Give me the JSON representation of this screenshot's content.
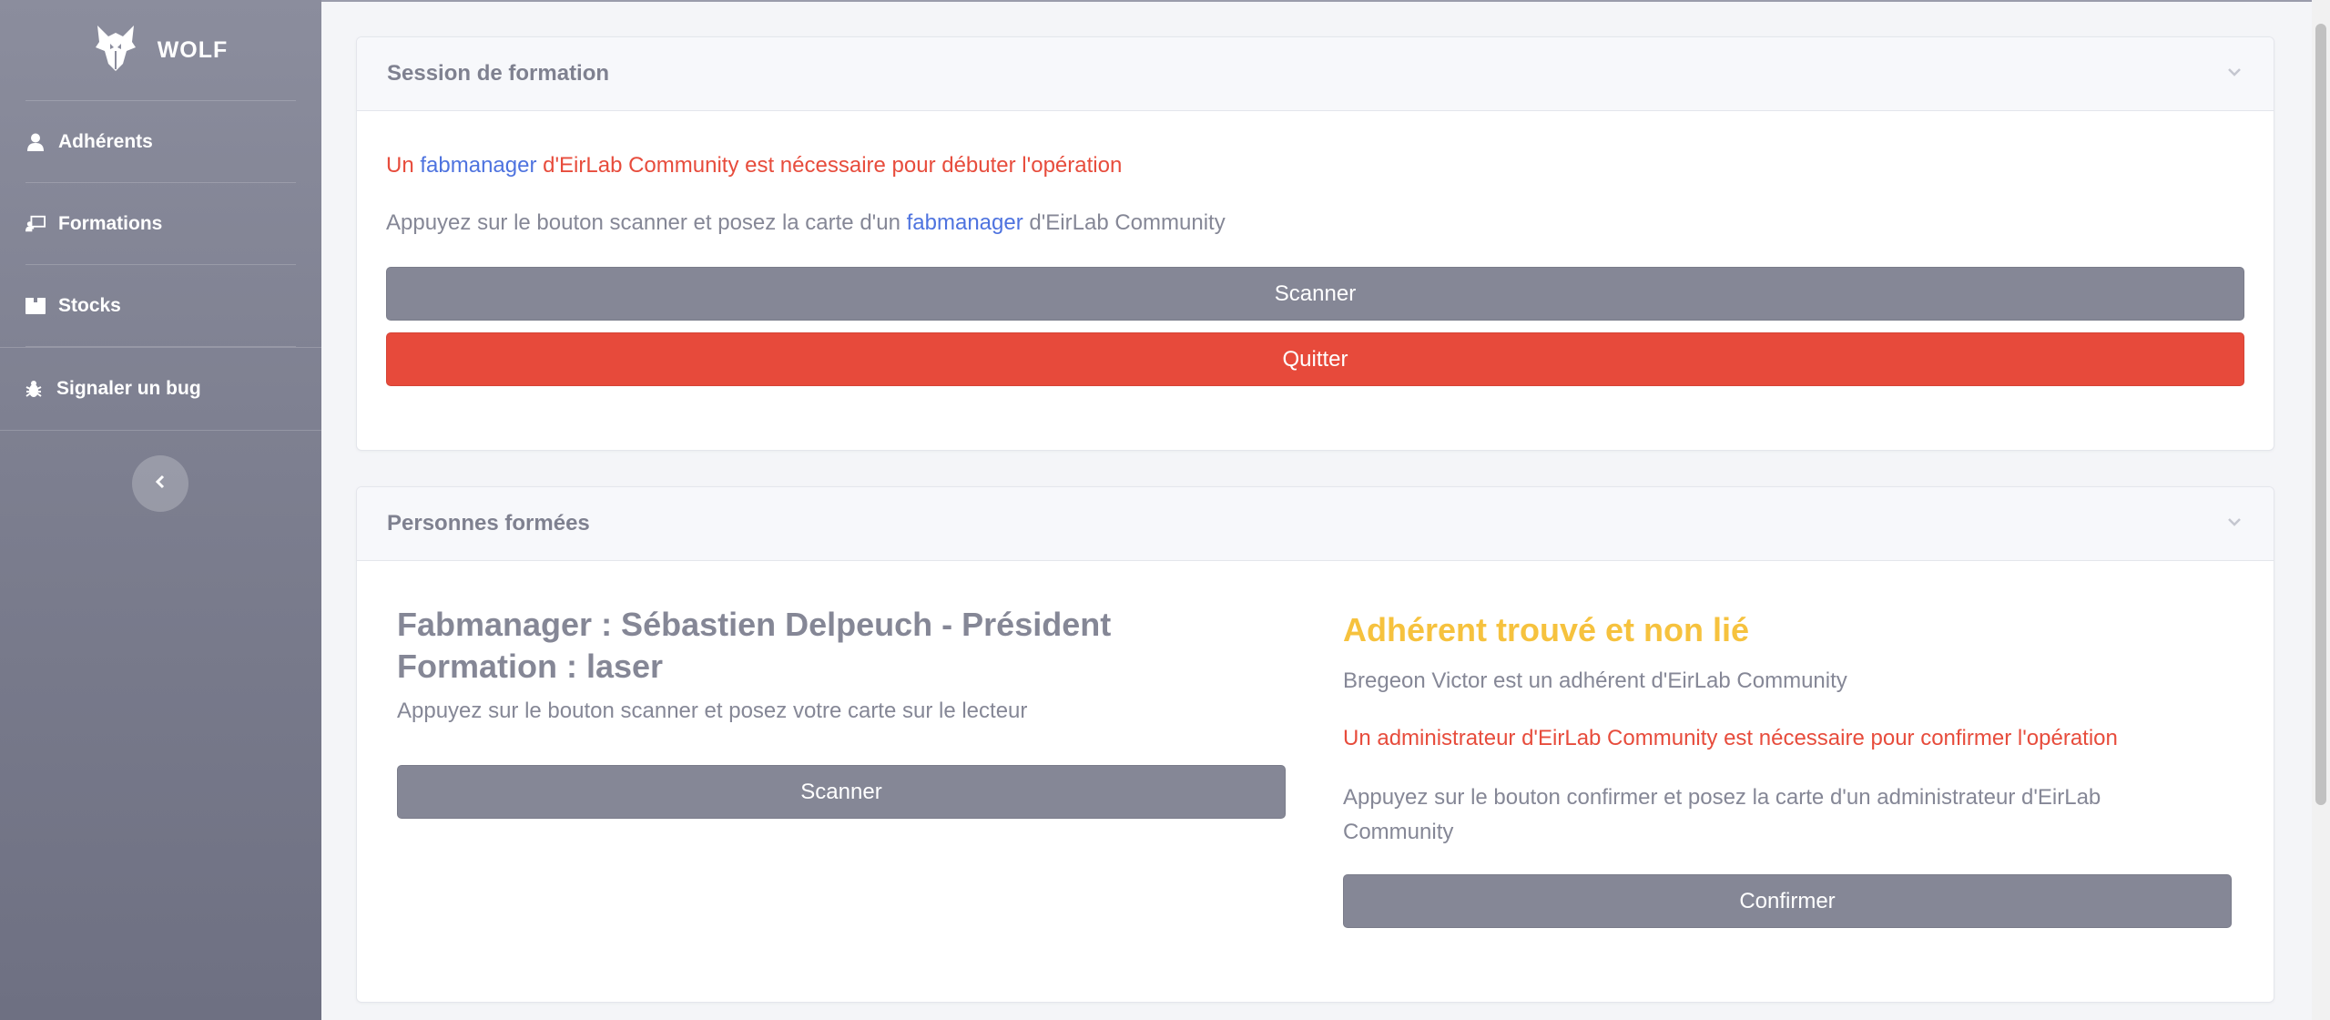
{
  "sidebar": {
    "brand": "WOLF",
    "items": [
      {
        "label": "Adhérents",
        "icon": "user-icon"
      },
      {
        "label": "Formations",
        "icon": "chalkboard-teacher-icon"
      },
      {
        "label": "Stocks",
        "icon": "box-icon"
      },
      {
        "label": "Signaler un bug",
        "icon": "bug-icon"
      }
    ],
    "collapse_icon": "chevron-left-icon"
  },
  "session_card": {
    "title": "Session de formation",
    "warning_prefix": "Un ",
    "warning_link": "fabmanager",
    "warning_suffix": " d'EirLab Community est nécessaire pour débuter l'opération",
    "info_prefix": "Appuyez sur le bouton scanner et posez la carte d'un ",
    "info_link": "fabmanager",
    "info_suffix": " d'EirLab Community",
    "scan_button": "Scanner",
    "quit_button": "Quitter"
  },
  "trained_card": {
    "title": "Personnes formées",
    "left": {
      "fabmanager_line": "Fabmanager : Sébastien Delpeuch - Président",
      "formation_line": "Formation : laser",
      "instruction": "Appuyez sur le bouton scanner et posez votre carte sur le lecteur",
      "scan_button": "Scanner"
    },
    "right": {
      "status_title": "Adhérent trouvé et non lié",
      "member_text": "Bregeon Victor est un adhérent d'EirLab Community",
      "admin_warning": "Un administrateur d'EirLab Community est nécessaire pour confirmer l'opération",
      "instruction": "Appuyez sur le bouton confirmer et posez la carte d'un administrateur d'EirLab Community",
      "confirm_button": "Confirmer"
    }
  },
  "colors": {
    "sidebar": "#7f8192",
    "danger": "#e74a3b",
    "primary_link": "#4e73df",
    "warning": "#f6c23e",
    "secondary": "#858796"
  }
}
